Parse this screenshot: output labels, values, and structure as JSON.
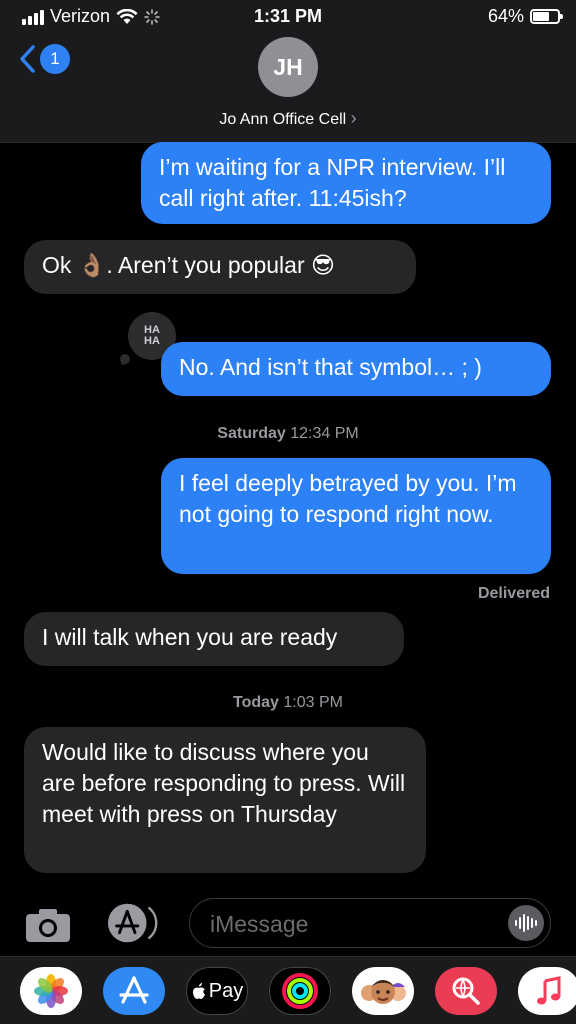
{
  "status_bar": {
    "carrier": "Verizon",
    "time": "1:31 PM",
    "battery": "64%"
  },
  "header": {
    "back_badge": "1",
    "avatar_initials": "JH",
    "contact_name": "Jo Ann Office Cell",
    "chevron": "›"
  },
  "messages": [
    {
      "dir": "out",
      "text": "I’m waiting for a NPR interview. I’ll call right after. 11:45ish?"
    },
    {
      "dir": "in",
      "text": "Ok 👌🏽.  Aren’t you popular 😎"
    },
    {
      "dir": "out",
      "text": "No. And isn’t that symbol…  ; )",
      "tapback": "HA HA"
    },
    {
      "meta_day": "Saturday",
      "meta_time": "12:34 PM"
    },
    {
      "dir": "out",
      "text": "I feel deeply betrayed by you. I’m not going to respond right now."
    },
    {
      "status": "Delivered"
    },
    {
      "dir": "in",
      "text": "I will talk when you are ready"
    },
    {
      "meta_day": "Today",
      "meta_time": "1:03 PM"
    },
    {
      "dir": "in",
      "text": "Would like to discuss where you are before responding to press.  Will meet with press on Thursday"
    }
  ],
  "input": {
    "placeholder": "iMessage"
  },
  "app_drawer": {
    "apple_pay_label": "Pay",
    "apps": [
      "photos-icon",
      "app-store-icon",
      "apple-pay-icon",
      "activity-icon",
      "memoji-icon",
      "search-images-icon",
      "music-icon"
    ]
  },
  "colors": {
    "outgoing": "#2d81f6",
    "incoming": "#262628",
    "header": "#1b1b1d",
    "badge": "#2f80f2"
  }
}
